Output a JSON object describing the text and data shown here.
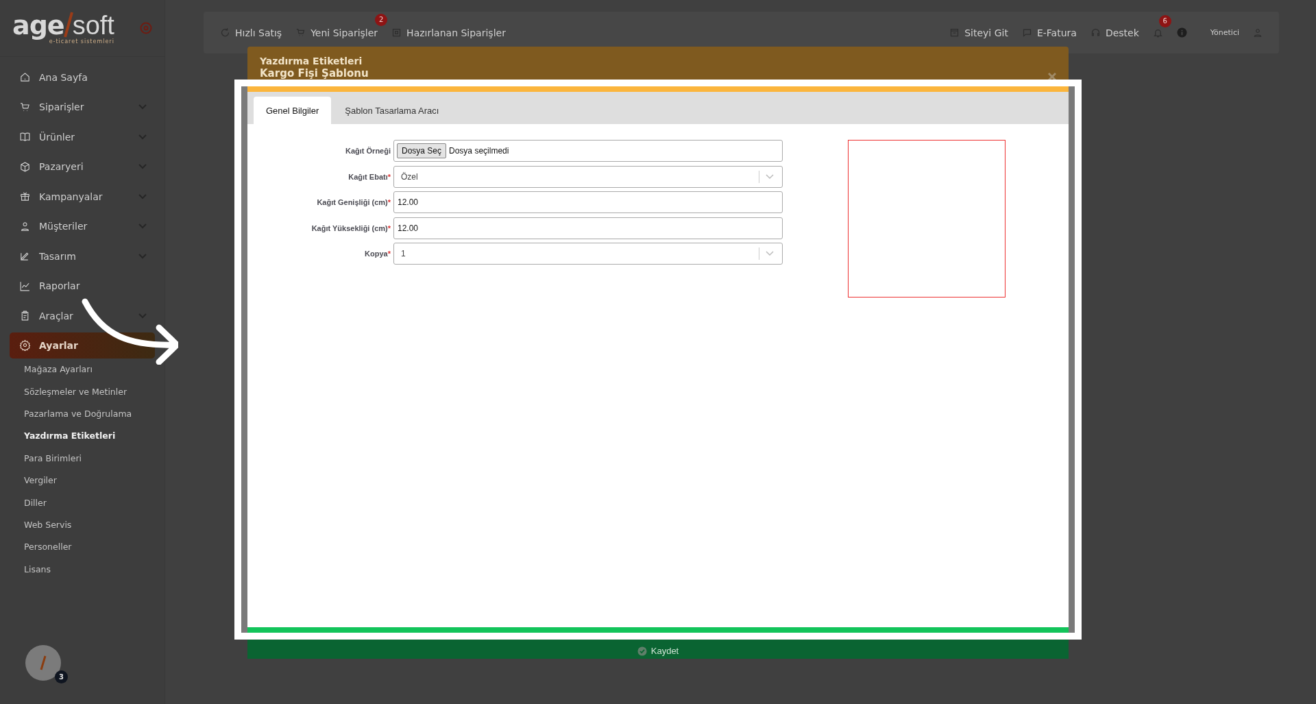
{
  "logo": {
    "main": "age",
    "second": "soft",
    "tagline": "e-ticaret sistemleri"
  },
  "sidebar": {
    "items": [
      {
        "label": "Ana Sayfa",
        "expandable": false,
        "selected": false
      },
      {
        "label": "Siparişler",
        "expandable": true,
        "selected": false
      },
      {
        "label": "Ürünler",
        "expandable": true,
        "selected": false
      },
      {
        "label": "Pazaryeri",
        "expandable": true,
        "selected": false
      },
      {
        "label": "Kampanyalar",
        "expandable": true,
        "selected": false
      },
      {
        "label": "Müşteriler",
        "expandable": true,
        "selected": false
      },
      {
        "label": "Tasarım",
        "expandable": true,
        "selected": false
      },
      {
        "label": "Raporlar",
        "expandable": false,
        "selected": false
      },
      {
        "label": "Araçlar",
        "expandable": true,
        "selected": false
      },
      {
        "label": "Ayarlar",
        "expandable": false,
        "selected": true
      }
    ],
    "submenu": [
      {
        "label": "Mağaza Ayarları",
        "selected": false
      },
      {
        "label": "Sözleşmeler ve Metinler",
        "selected": false
      },
      {
        "label": "Pazarlama ve Doğrulama",
        "selected": false
      },
      {
        "label": "Yazdırma Etiketleri",
        "selected": true
      },
      {
        "label": "Para Birimleri",
        "selected": false
      },
      {
        "label": "Vergiler",
        "selected": false
      },
      {
        "label": "Diller",
        "selected": false
      },
      {
        "label": "Web Servis",
        "selected": false
      },
      {
        "label": "Personeller",
        "selected": false
      },
      {
        "label": "Lisans",
        "selected": false
      }
    ],
    "avatar_badge": "3"
  },
  "topbar": {
    "left": [
      {
        "label": "Hızlı Satış"
      },
      {
        "label": "Yeni Siparişler",
        "badge": "2"
      },
      {
        "label": "Hazırlanan Siparişler"
      }
    ],
    "right": [
      {
        "label": "Siteyi Git"
      },
      {
        "label": "E-Fatura"
      },
      {
        "label": "Destek"
      }
    ],
    "notifications_badge": "6",
    "user": "Yönetici"
  },
  "modal": {
    "title": "Yazdırma Etiketleri",
    "subtitle": "Kargo Fişi Şablonu",
    "tabs": [
      {
        "label": "Genel Bilgiler",
        "selected": true
      },
      {
        "label": "Şablon Tasarlama Aracı",
        "selected": false
      }
    ],
    "fields": [
      {
        "kind": "file",
        "label": "Kağıt Örneği",
        "button": "Dosya Seç",
        "value": "Dosya seçilmedi"
      },
      {
        "kind": "select",
        "label": "Kağıt Ebatı",
        "required_mark": "*",
        "value": "Özel"
      },
      {
        "kind": "text",
        "label": "Kağıt Genişliği (cm)",
        "required_mark": "*",
        "value": "12.00"
      },
      {
        "kind": "text",
        "label": "Kağıt Yüksekliği (cm)",
        "required_mark": "*",
        "value": "12.00"
      },
      {
        "kind": "select",
        "label": "Kopya",
        "required_mark": "*",
        "value": "1"
      }
    ],
    "save_button": "Kaydet"
  }
}
